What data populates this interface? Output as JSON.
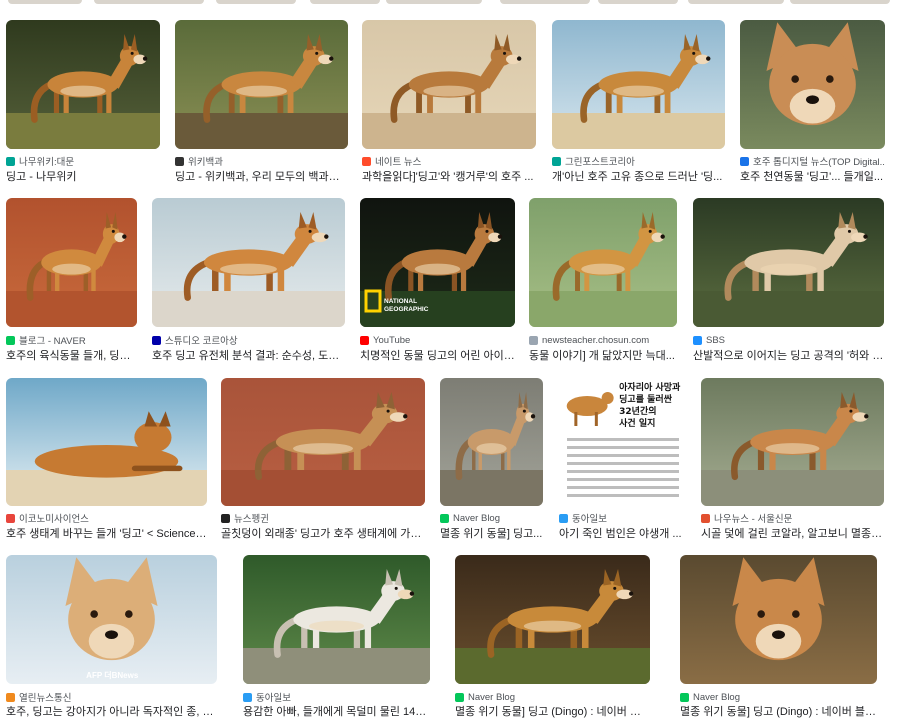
{
  "colors": {
    "namu": "#00a495",
    "wiki": "#333333",
    "nate": "#ff4c2b",
    "naver": "#03c75a",
    "hankyung": "#1a73e8",
    "studio": "#0000aa",
    "youtube": "#ff0000",
    "chosun": "#9aa5b1",
    "sbs": "#1e90ff",
    "econo": "#e8453c",
    "nyus": "#222222",
    "donga": "#2a9df4",
    "nau": "#e2502f",
    "yonhap": "#f08a1e"
  },
  "rows": [
    [
      {
        "source": "나무위키:대문",
        "caption": "딩고 - 나무위키",
        "icon": "namu-icon",
        "favcolor": "#00a495"
      },
      {
        "source": "위키백과",
        "caption": "딩고 - 위키백과, 우리 모두의 백과사전",
        "icon": "wiki-icon",
        "favcolor": "#333333"
      },
      {
        "source": "네이트 뉴스",
        "caption": "과학을읽다]'딩고'와 '캥거루'의 호주 ...",
        "icon": "nate-icon",
        "favcolor": "#ff4c2b"
      },
      {
        "source": "그린포스트코리아",
        "caption": "개'아닌 호주 고유 종으로 드러난 '딩...",
        "icon": "greenpost-icon",
        "favcolor": "#00a495"
      },
      {
        "source": "호주 톱디지털 뉴스(TOP Digital...",
        "caption": "호주 천연동물 '딩고'... 들개일...",
        "icon": "topdigital-icon",
        "favcolor": "#1a73e8"
      }
    ],
    [
      {
        "source": "블로그 - NAVER",
        "caption": "호주의 육식동물 들개, 딩고...",
        "icon": "naver-icon",
        "favcolor": "#03c75a"
      },
      {
        "source": "스튜디오 코르아상",
        "caption": "호주 딩고 유전체 분석 결과: 순수성, 도태 ...",
        "icon": "studio-icon",
        "favcolor": "#0000aa"
      },
      {
        "source": "YouTube",
        "caption": "치명적인 동물 딩고의 어린 아이 ...",
        "icon": "youtube-icon",
        "favcolor": "#ff0000",
        "badge": "NATIONAL GEOGRAPHIC"
      },
      {
        "source": "newsteacher.chosun.com",
        "caption": "동물 이야기] 개 닮았지만 늑대...",
        "icon": "chosun-icon",
        "favcolor": "#9aa5b1"
      },
      {
        "source": "SBS",
        "caption": "산발적으로 이어지는 딩고 공격의 '허와 실...",
        "icon": "sbs-icon",
        "favcolor": "#1e90ff"
      }
    ],
    [
      {
        "source": "이코노미사이언스",
        "caption": "호주 생태계 바꾸는 들개 '딩고' < Science ...",
        "icon": "economy-icon",
        "favcolor": "#e8453c"
      },
      {
        "source": "뉴스펭귄",
        "caption": "골칫덩이 외래종' 딩고가 호주 생태계에 가져...",
        "icon": "newspenguin-icon",
        "favcolor": "#222222"
      },
      {
        "source": "Naver Blog",
        "caption": "멸종 위기 동물] 딩고...",
        "icon": "naver-icon",
        "favcolor": "#03c75a"
      },
      {
        "source": "동아일보",
        "caption": "아기 죽인 범인은 야생개 ...",
        "icon": "donga-icon",
        "favcolor": "#2a9df4",
        "poster_title": "아자리아 사망과 딩고를 둘러싼 32년간의 사건 일지"
      },
      {
        "source": "나우뉴스 - 서울신문",
        "caption": "시골 덫에 걸린 코알라, 알고보니 멸종위...",
        "icon": "nownews-icon",
        "favcolor": "#e2502f"
      }
    ],
    [
      {
        "source": "열린뉴스통신",
        "caption": "호주, 딩고는 강아지가 아니라 독자적인 종, 보전...",
        "icon": "onews-icon",
        "favcolor": "#f08a1e",
        "watermark": "AFP 더BNews"
      },
      {
        "source": "동아일보",
        "caption": "용감한 아빠, 들개에게 목덜미 물린 14개...",
        "icon": "donga-icon",
        "favcolor": "#2a9df4"
      },
      {
        "source": "Naver Blog",
        "caption": "멸종 위기 동물] 딩고 (Dingo) : 네이버 블로그",
        "icon": "naver-icon",
        "favcolor": "#03c75a"
      },
      {
        "source": "Naver Blog",
        "caption": "멸종 위기 동물] 딩고 (Dingo) : 네이버 블로그",
        "icon": "naver-icon",
        "favcolor": "#03c75a"
      }
    ]
  ]
}
